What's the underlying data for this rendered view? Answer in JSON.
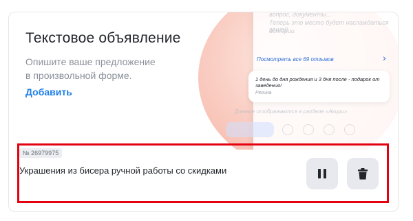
{
  "promo": {
    "title": "Текстовое объявление",
    "description": "Опишите ваше предложение в произвольной форме.",
    "add_link": "Добавить",
    "mock": {
      "faded_line1": "вопрос, документы...",
      "faded_line2": "Теперь это место будет наслаждаться вашей",
      "faded_line3": "истории",
      "reviews_link": "Посмотреть все 69 отзывов",
      "review_text": "1 день до дня рождения и 3 дня после - подарок от заведения!",
      "review_author": "Регина",
      "faded_line4": "Данные отображаются в разделе «Акции»"
    }
  },
  "ad": {
    "number": "№ 26979975",
    "title": "Украшения из бисера ручной работы со скидками",
    "pause_icon": "pause-icon",
    "delete_icon": "trash-icon"
  },
  "colors": {
    "link": "#1f7ee6",
    "highlight": "#e4000f",
    "button_bg": "#e8e9ee",
    "icon": "#22252b"
  }
}
